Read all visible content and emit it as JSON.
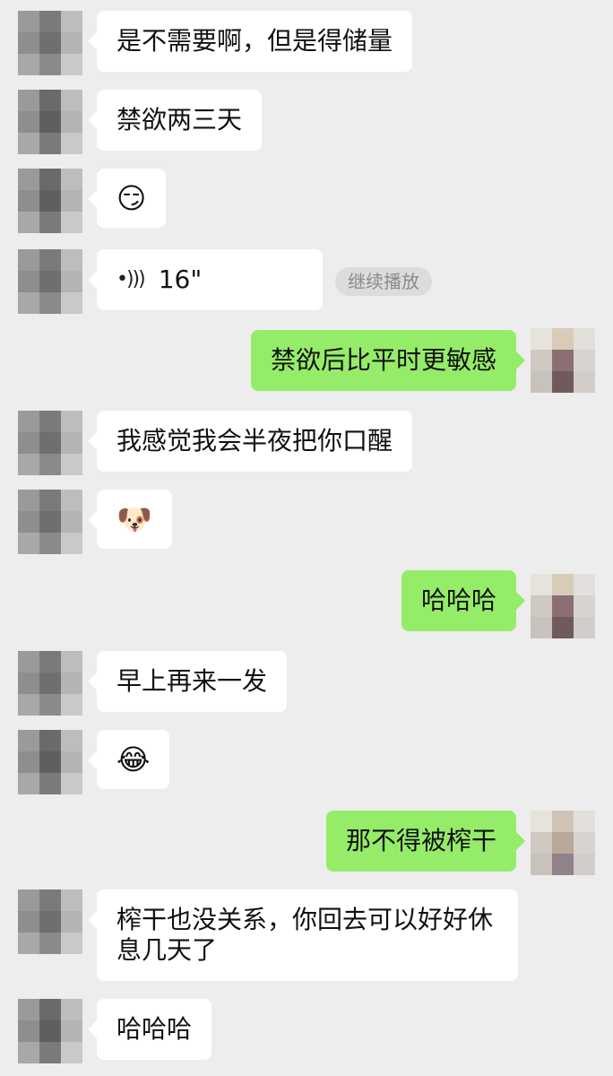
{
  "messages": [
    {
      "text": "是不需要啊，但是得储量"
    },
    {
      "text": "禁欲两三天"
    },
    {
      "emoji": "😏"
    },
    {
      "voice_duration": "16\"",
      "voice_icon": "voice-wave-icon",
      "continue_label": "继续播放"
    },
    {
      "text": "禁欲后比平时更敏感"
    },
    {
      "text": "我感觉我会半夜把你口醒"
    },
    {
      "emoji": "🐶"
    },
    {
      "text": "哈哈哈"
    },
    {
      "text": "早上再来一发"
    },
    {
      "emoji": "😂"
    },
    {
      "text": "那不得被榨干"
    },
    {
      "text": "榨干也没关系，你回去可以好好休息几天了"
    },
    {
      "text": "哈哈哈"
    }
  ],
  "colors": {
    "background": "#ededed",
    "incoming_bubble": "#ffffff",
    "outgoing_bubble": "#95ec69",
    "pill": "#dcdcdc"
  }
}
